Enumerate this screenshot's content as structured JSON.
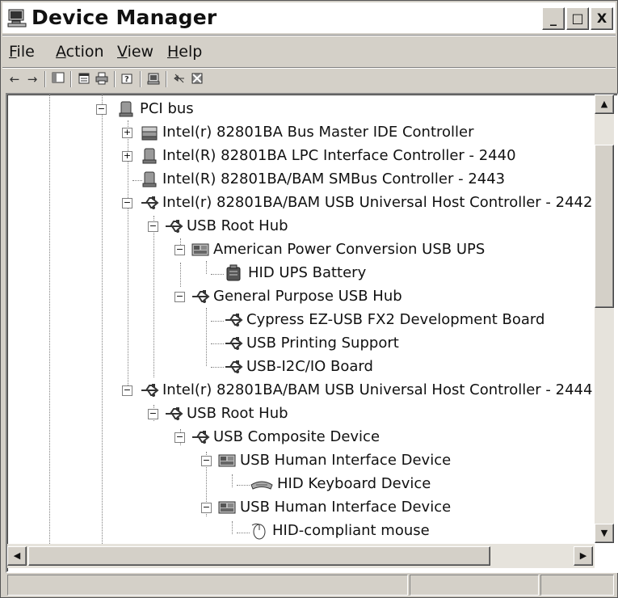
{
  "window": {
    "title": "Device Manager",
    "controls": {
      "minimize": "_",
      "maximize": "□",
      "close": "X"
    }
  },
  "menu": {
    "items": [
      {
        "label": "File",
        "accel": "F",
        "rest": "ile"
      },
      {
        "label": "Action",
        "accel": "A",
        "rest": "ction"
      },
      {
        "label": "View",
        "accel": "V",
        "rest": "iew"
      },
      {
        "label": "Help",
        "accel": "H",
        "rest": "elp"
      }
    ]
  },
  "toolbar": {
    "icons": [
      "back-arrow-icon",
      "forward-arrow-icon",
      "show-hide-console-tree-icon",
      "properties-icon",
      "print-icon",
      "help-icon",
      "scan-hardware-icon",
      "disable-device-icon",
      "uninstall-device-icon"
    ]
  },
  "tree": {
    "rows": [
      {
        "label": "PCI bus",
        "icon": "pci-bus-icon",
        "expander": "−"
      },
      {
        "label": "Intel(r) 82801BA Bus Master IDE Controller",
        "icon": "ide-controller-icon",
        "expander": "+"
      },
      {
        "label": "Intel(R) 82801BA LPC Interface Controller - 2440",
        "icon": "system-device-icon",
        "expander": "+"
      },
      {
        "label": "Intel(R) 82801BA/BAM SMBus Controller - 2443",
        "icon": "system-device-icon",
        "expander": ""
      },
      {
        "label": "Intel(r) 82801BA/BAM USB Universal Host Controller - 2442",
        "icon": "usb-icon",
        "expander": "−"
      },
      {
        "label": "USB Root Hub",
        "icon": "usb-icon",
        "expander": "−"
      },
      {
        "label": "American Power Conversion USB UPS",
        "icon": "hid-icon",
        "expander": "−"
      },
      {
        "label": "HID UPS Battery",
        "icon": "battery-icon",
        "expander": ""
      },
      {
        "label": "General Purpose USB Hub",
        "icon": "usb-icon",
        "expander": "−"
      },
      {
        "label": "Cypress EZ-USB FX2 Development Board",
        "icon": "usb-icon",
        "expander": ""
      },
      {
        "label": "USB Printing Support",
        "icon": "usb-icon",
        "expander": ""
      },
      {
        "label": "USB-I2C/IO Board",
        "icon": "usb-icon",
        "expander": ""
      },
      {
        "label": "Intel(r) 82801BA/BAM USB Universal Host Controller - 2444",
        "icon": "usb-icon",
        "expander": "−"
      },
      {
        "label": "USB Root Hub",
        "icon": "usb-icon",
        "expander": "−"
      },
      {
        "label": "USB Composite Device",
        "icon": "usb-icon",
        "expander": "−"
      },
      {
        "label": "USB Human Interface Device",
        "icon": "hid-icon",
        "expander": "−"
      },
      {
        "label": "HID Keyboard Device",
        "icon": "keyboard-icon",
        "expander": ""
      },
      {
        "label": "USB Human Interface Device",
        "icon": "hid-icon",
        "expander": "−"
      },
      {
        "label": "HID-compliant mouse",
        "icon": "mouse-icon",
        "expander": ""
      }
    ]
  },
  "scrollbars": {
    "up_arrow": "▲",
    "down_arrow": "▼",
    "left_arrow": "◀",
    "right_arrow": "▶"
  }
}
